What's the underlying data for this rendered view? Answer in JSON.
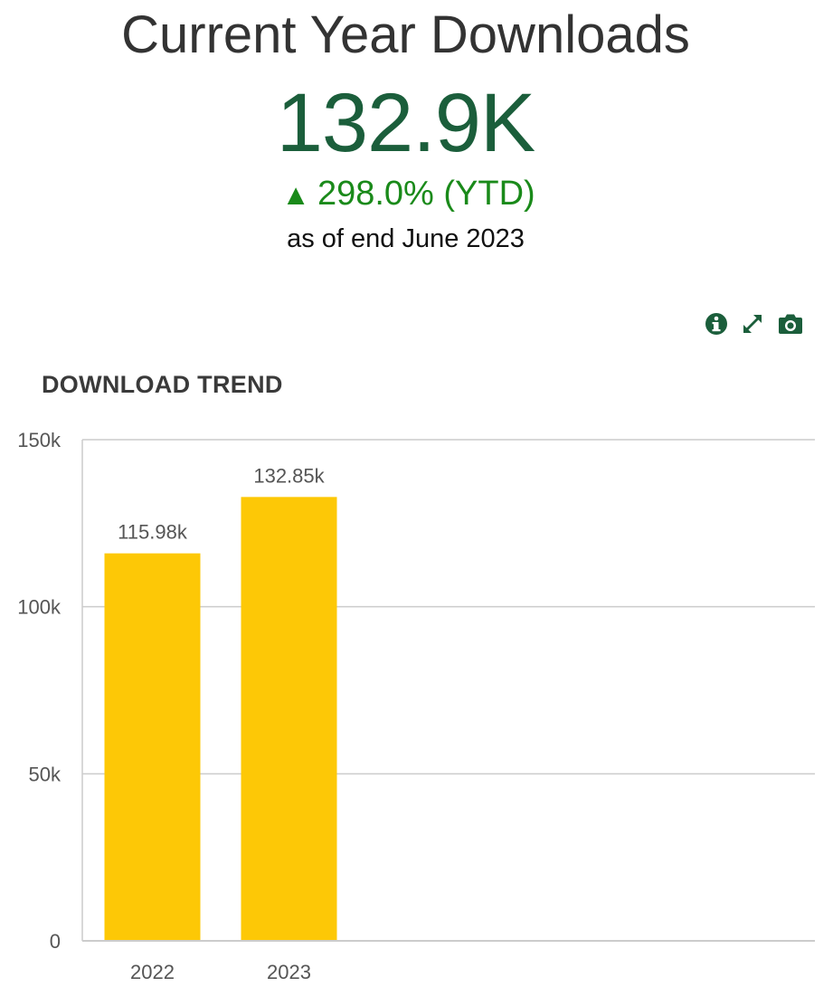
{
  "kpi": {
    "title": "Current Year Downloads",
    "value": "132.9K",
    "change_arrow": "▲",
    "change_text": "298.0% (YTD)",
    "as_of": "as of end June 2023",
    "value_color": "#1b5e3b",
    "change_color": "#1a8a1a"
  },
  "toolbar": {
    "icons": [
      "info-icon",
      "expand-icon",
      "camera-icon"
    ],
    "icon_color": "#1b5e3b"
  },
  "chart_data": {
    "type": "bar",
    "title": "DOWNLOAD TREND",
    "categories": [
      "2022",
      "2023"
    ],
    "values": [
      115980,
      132850
    ],
    "value_labels": [
      "115.98k",
      "132.85k"
    ],
    "ylim": [
      0,
      150000
    ],
    "yticks": [
      0,
      50000,
      100000,
      150000
    ],
    "ytick_labels": [
      "0",
      "50k",
      "100k",
      "150k"
    ],
    "bar_color": "#fdc806",
    "grid": true
  }
}
